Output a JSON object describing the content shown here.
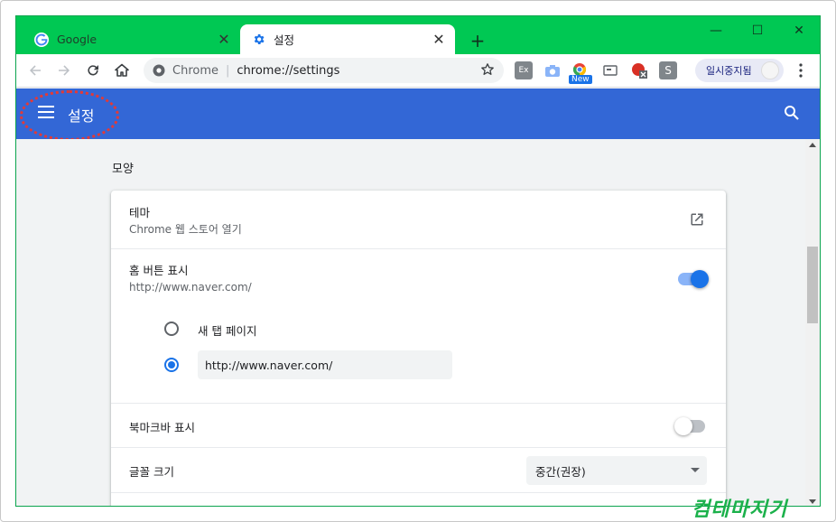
{
  "tabs": [
    {
      "title": "Google",
      "favicon": "google-g-icon",
      "active": false
    },
    {
      "title": "설정",
      "favicon": "settings-gear-icon",
      "active": true
    }
  ],
  "omnibox": {
    "site_label": "Chrome",
    "url": "chrome://settings"
  },
  "profile": {
    "label": "일시중지됨"
  },
  "extensions": [
    {
      "name": "Ex",
      "icon": "ex-extension-icon"
    },
    {
      "name": "camera",
      "icon": "camera-icon"
    },
    {
      "name": "New",
      "icon": "chrome-new-extension-icon"
    },
    {
      "name": "screen",
      "icon": "screen-extension-icon"
    },
    {
      "name": "blocked",
      "icon": "red-extension-icon"
    },
    {
      "name": "S",
      "icon": "s-extension-icon"
    }
  ],
  "header": {
    "title": "설정"
  },
  "section": {
    "title": "모양"
  },
  "settings": {
    "theme": {
      "label": "테마",
      "sub": "Chrome 웹 스토어 열기"
    },
    "home_button": {
      "label": "홈 버튼 표시",
      "sub": "http://www.naver.com/",
      "enabled": true,
      "options": [
        {
          "label": "새 탭 페이지",
          "selected": false
        },
        {
          "value": "http://www.naver.com/",
          "selected": true
        }
      ]
    },
    "bookmarks_bar": {
      "label": "북마크바 표시",
      "enabled": false
    },
    "font_size": {
      "label": "글꼴 크기",
      "value": "중간(권장)"
    }
  },
  "watermark": {
    "text": "컴테마지기"
  },
  "colors": {
    "tabstrip": "#00c853",
    "header": "#3367d6",
    "accent": "#1a73e8"
  }
}
